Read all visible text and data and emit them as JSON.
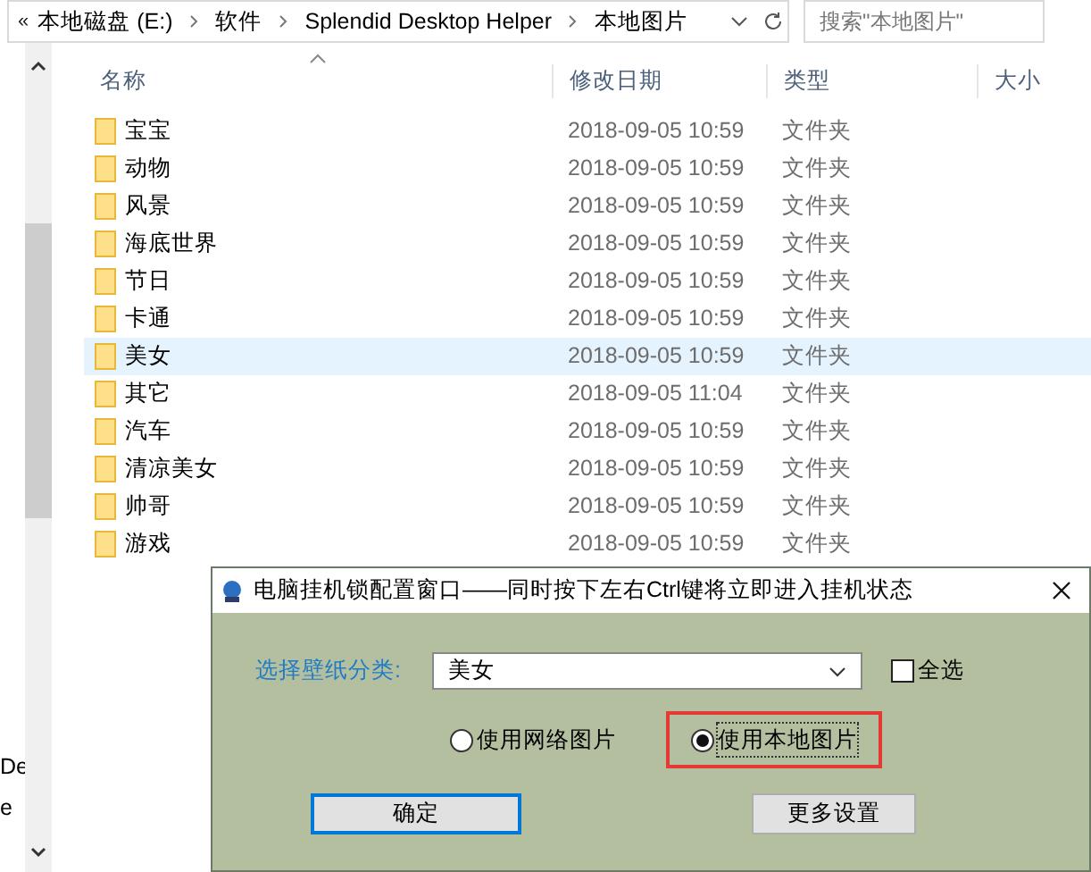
{
  "address_bar": {
    "overflow": "«",
    "crumbs": [
      "本地磁盘 (E:)",
      "软件",
      "Splendid Desktop Helper",
      "本地图片"
    ]
  },
  "search": {
    "placeholder": "搜索\"本地图片\""
  },
  "columns": [
    {
      "label": "名称"
    },
    {
      "label": "修改日期"
    },
    {
      "label": "类型"
    },
    {
      "label": "大小"
    }
  ],
  "rows": [
    {
      "name": "宝宝",
      "date": "2018-09-05 10:59",
      "type": "文件夹",
      "hovered": false
    },
    {
      "name": "动物",
      "date": "2018-09-05 10:59",
      "type": "文件夹",
      "hovered": false
    },
    {
      "name": "风景",
      "date": "2018-09-05 10:59",
      "type": "文件夹",
      "hovered": false
    },
    {
      "name": "海底世界",
      "date": "2018-09-05 10:59",
      "type": "文件夹",
      "hovered": false
    },
    {
      "name": "节日",
      "date": "2018-09-05 10:59",
      "type": "文件夹",
      "hovered": false
    },
    {
      "name": "卡通",
      "date": "2018-09-05 10:59",
      "type": "文件夹",
      "hovered": false
    },
    {
      "name": "美女",
      "date": "2018-09-05 10:59",
      "type": "文件夹",
      "hovered": true
    },
    {
      "name": "其它",
      "date": "2018-09-05 11:04",
      "type": "文件夹",
      "hovered": false
    },
    {
      "name": "汽车",
      "date": "2018-09-05 10:59",
      "type": "文件夹",
      "hovered": false
    },
    {
      "name": "清凉美女",
      "date": "2018-09-05 10:59",
      "type": "文件夹",
      "hovered": false
    },
    {
      "name": "帅哥",
      "date": "2018-09-05 10:59",
      "type": "文件夹",
      "hovered": false
    },
    {
      "name": "游戏",
      "date": "2018-09-05 10:59",
      "type": "文件夹",
      "hovered": false
    }
  ],
  "nav_fragments": [
    "De",
    "e"
  ],
  "dialog": {
    "title": "电脑挂机锁配置窗口——同时按下左右Ctrl键将立即进入挂机状态",
    "category_label": "选择壁纸分类:",
    "category_value": "美女",
    "select_all": {
      "label": "全选",
      "checked": false
    },
    "radios": [
      {
        "label": "使用网络图片",
        "selected": false
      },
      {
        "label": "使用本地图片",
        "selected": true
      }
    ],
    "buttons": [
      "确定",
      "更多设置"
    ]
  }
}
